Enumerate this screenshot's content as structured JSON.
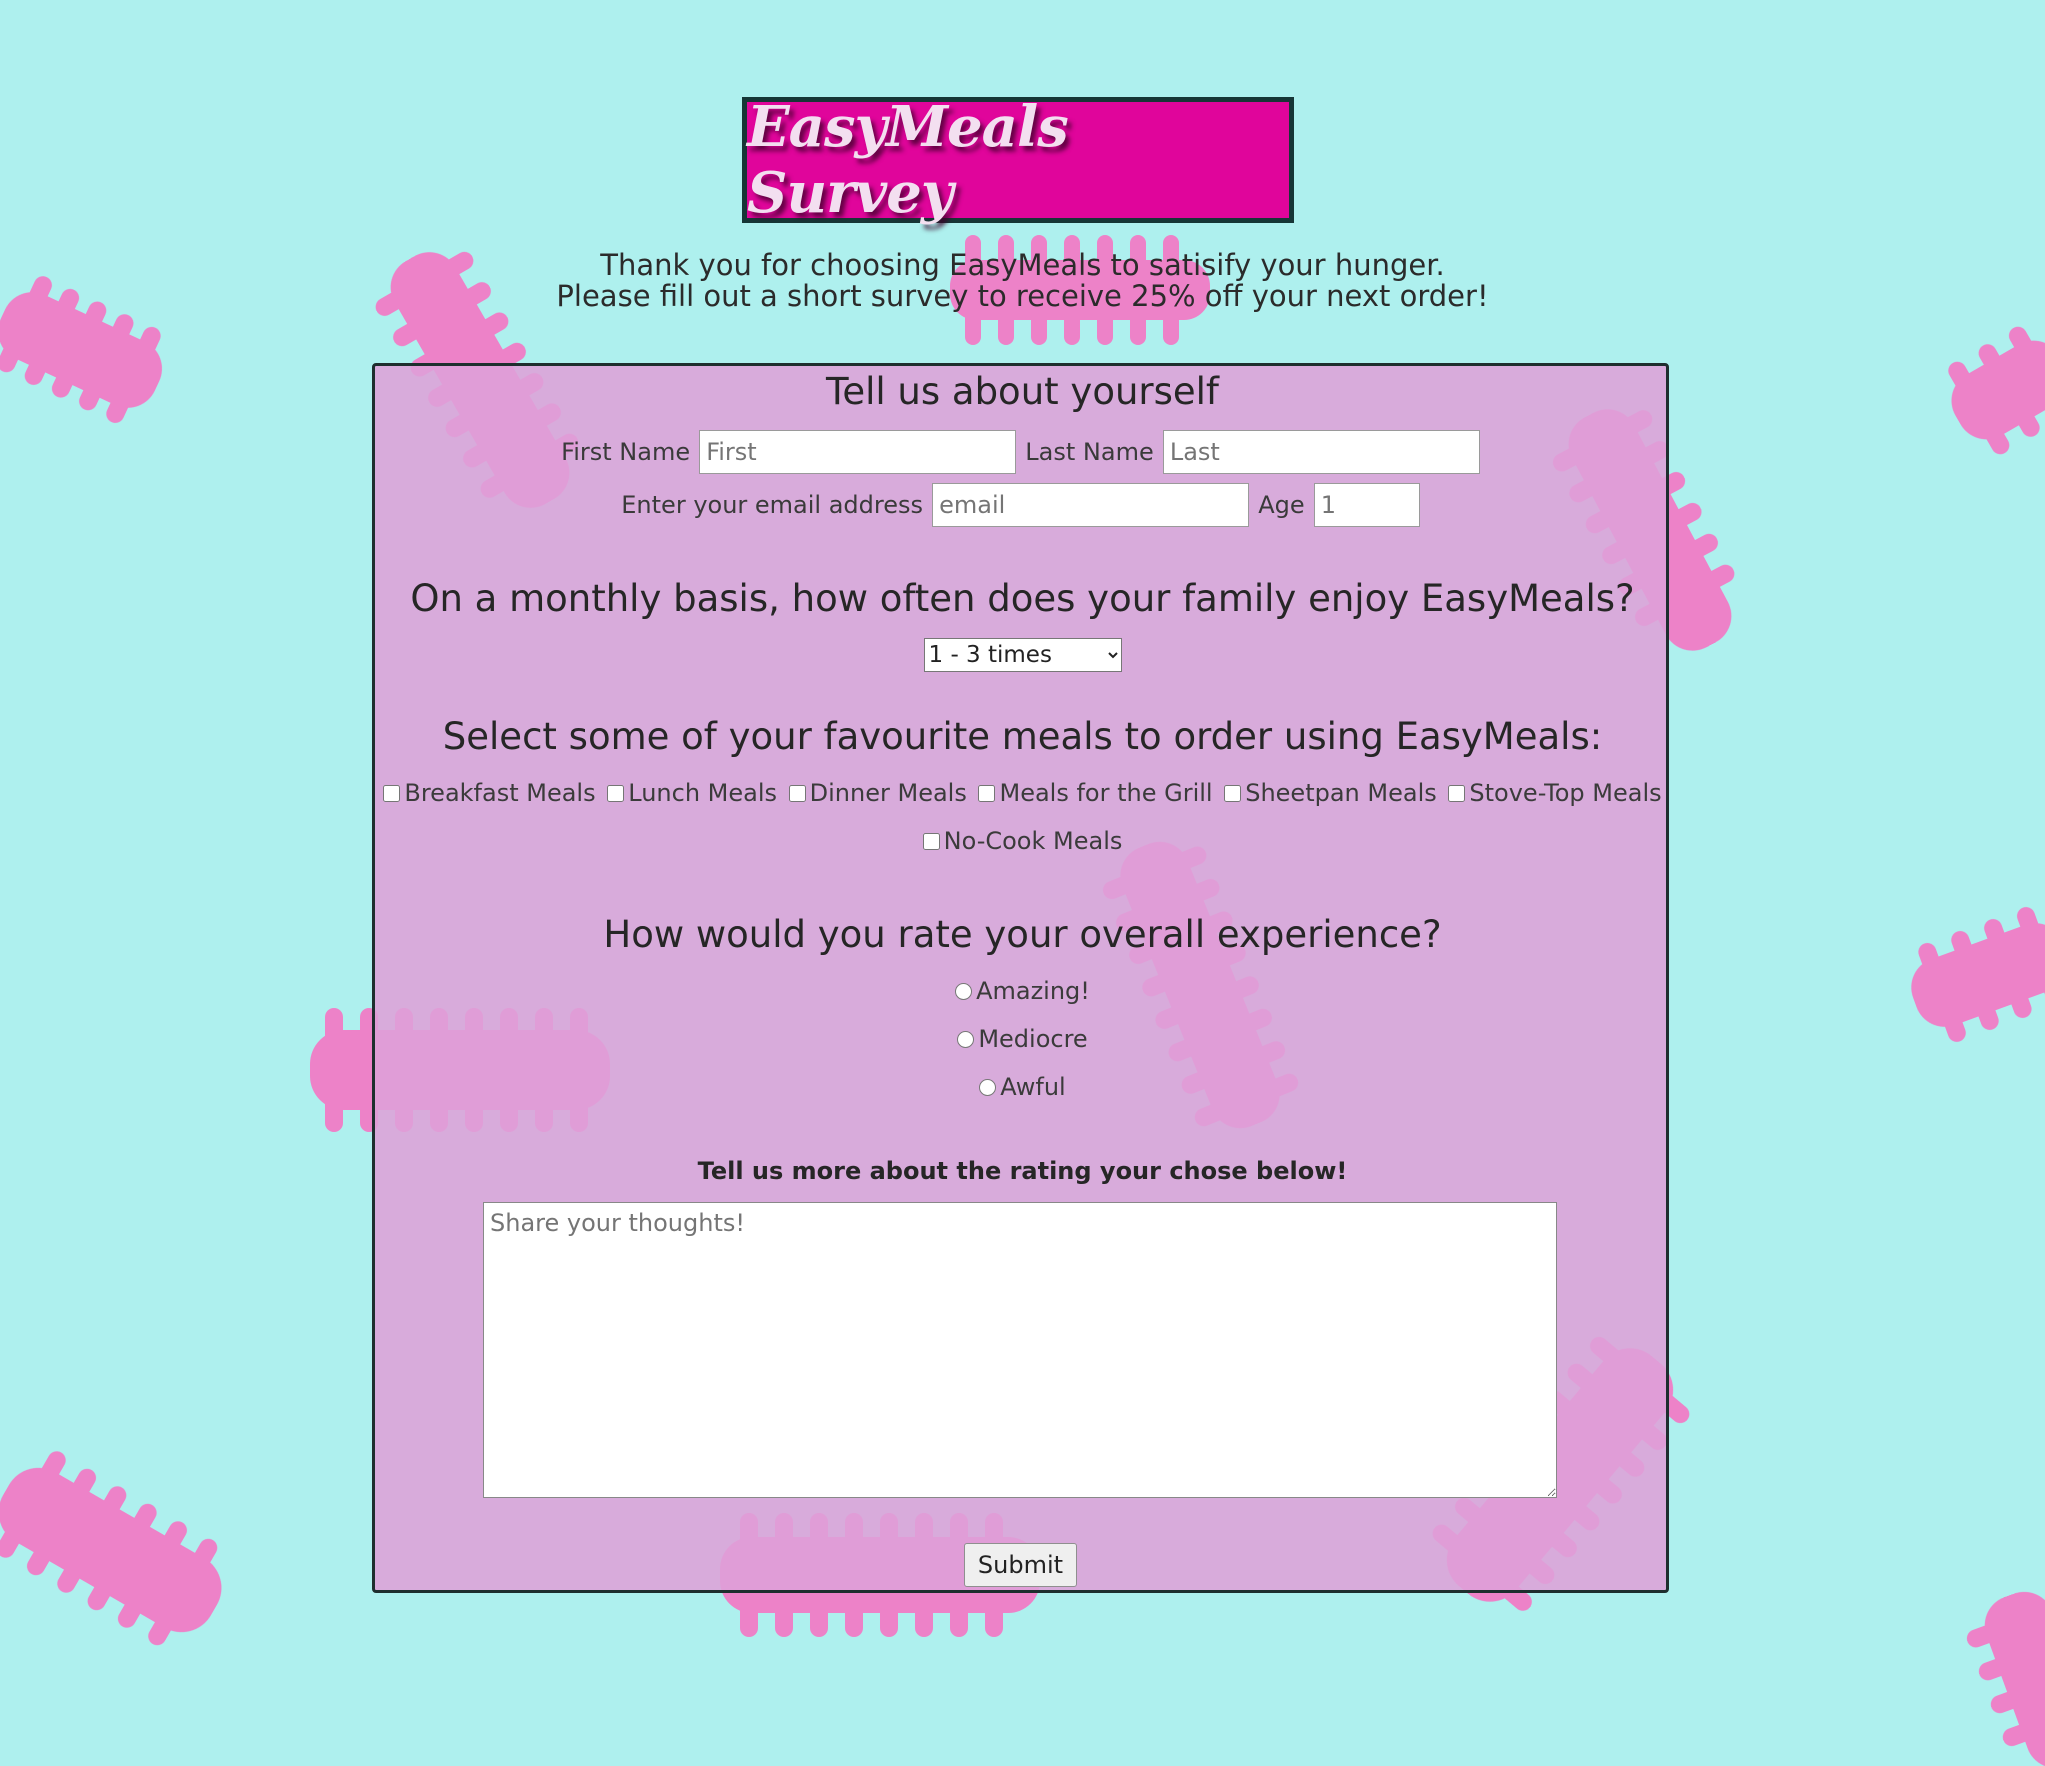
{
  "header": {
    "title": "EasyMeals Survey"
  },
  "intro": {
    "line1": "Thank you for choosing EasyMeals to satisify your hunger.",
    "line2": "Please fill out a short survey to receive 25% off your next order!"
  },
  "about": {
    "heading": "Tell us about yourself",
    "first_name_label": "First Name",
    "first_name_placeholder": "First",
    "last_name_label": "Last Name",
    "last_name_placeholder": "Last",
    "email_label": "Enter your email address",
    "email_placeholder": "email",
    "age_label": "Age",
    "age_placeholder": "1"
  },
  "frequency": {
    "question": "On a monthly basis, how often does your family enjoy EasyMeals?",
    "selected": "1 - 3 times"
  },
  "meals": {
    "question": "Select some of your favourite meals to order using EasyMeals:",
    "options": [
      "Breakfast Meals",
      "Lunch Meals",
      "Dinner Meals",
      "Meals for the Grill",
      "Sheetpan Meals",
      "Stove-Top Meals",
      "No-Cook Meals"
    ]
  },
  "rating": {
    "question": "How would you rate your overall experience?",
    "options": [
      "Amazing!",
      "Mediocre",
      "Awful"
    ]
  },
  "comments": {
    "heading": "Tell us more about the rating your chose below!",
    "placeholder": "Share your thoughts!"
  },
  "submit_label": "Submit",
  "colors": {
    "background": "#aef0ee",
    "title_box": "#e0059b",
    "panel": "#dea0d8",
    "pasta": "#f07ac8"
  }
}
